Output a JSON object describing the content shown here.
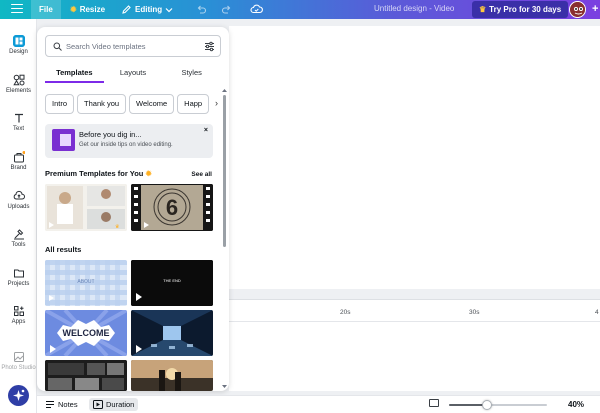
{
  "topbar": {
    "file_label": "File",
    "resize_label": "Resize",
    "editing_label": "Editing",
    "doc_title": "Untitled design - Video",
    "try_pro_label": "Try Pro for 30 days"
  },
  "rail": {
    "items": [
      {
        "label": "Design",
        "icon": "design-icon"
      },
      {
        "label": "Elements",
        "icon": "elements-icon"
      },
      {
        "label": "Text",
        "icon": "text-icon"
      },
      {
        "label": "Brand",
        "icon": "brand-icon"
      },
      {
        "label": "Uploads",
        "icon": "uploads-icon"
      },
      {
        "label": "Tools",
        "icon": "tools-icon"
      },
      {
        "label": "Projects",
        "icon": "projects-icon"
      },
      {
        "label": "Apps",
        "icon": "apps-icon"
      },
      {
        "label": "Photo Studio",
        "icon": "photo-studio-icon"
      }
    ]
  },
  "panel": {
    "search_placeholder": "Search Video templates",
    "tabs": [
      {
        "label": "Templates",
        "active": true
      },
      {
        "label": "Layouts",
        "active": false
      },
      {
        "label": "Styles",
        "active": false
      }
    ],
    "chips": [
      "Intro",
      "Thank you",
      "Welcome",
      "Happ"
    ],
    "tip": {
      "title": "Before you dig in...",
      "text": "Get our inside tips on video editing."
    },
    "premium_title": "Premium Templates for You",
    "see_all_label": "See all",
    "all_results_title": "All results",
    "thumb_texts": {
      "the_end": "THE END",
      "welcome": "WELCOME",
      "countdown": "6",
      "grid_caption": "ABOUT"
    }
  },
  "timeline": {
    "marks": [
      "20s",
      "30s",
      "4"
    ]
  },
  "bottombar": {
    "notes_label": "Notes",
    "duration_label": "Duration",
    "zoom_value": "40%",
    "zoom_fraction": 0.4
  },
  "colors": {
    "accent": "#7d2ae8",
    "active_rail": "#0c9ad6",
    "try_pro_bg": "#3a2fa8"
  }
}
